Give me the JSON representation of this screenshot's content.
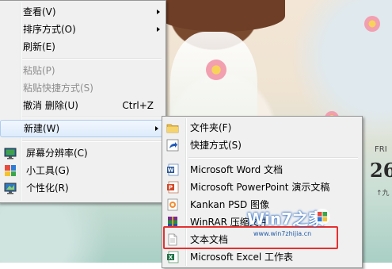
{
  "context_menu": {
    "items": [
      {
        "label": "查看(V)",
        "has_submenu": true
      },
      {
        "label": "排序方式(O)",
        "has_submenu": true
      },
      {
        "label": "刷新(E)"
      },
      {
        "label": "粘贴(P)",
        "disabled": true
      },
      {
        "label": "粘贴快捷方式(S)",
        "disabled": true
      },
      {
        "label": "撤消 删除(U)",
        "shortcut": "Ctrl+Z"
      },
      {
        "label": "新建(W)",
        "has_submenu": true,
        "highlighted": true
      },
      {
        "label": "屏幕分辨率(C)",
        "icon": "display-icon"
      },
      {
        "label": "小工具(G)",
        "icon": "gadgets-icon"
      },
      {
        "label": "个性化(R)",
        "icon": "personalize-icon"
      }
    ]
  },
  "new_submenu": {
    "items": [
      {
        "label": "文件夹(F)",
        "icon": "folder-icon"
      },
      {
        "label": "快捷方式(S)",
        "icon": "shortcut-icon"
      },
      {
        "label": "Microsoft Word 文档",
        "icon": "word-doc-icon"
      },
      {
        "label": "Microsoft PowerPoint 演示文稿",
        "icon": "powerpoint-icon"
      },
      {
        "label": "Kankan PSD 图像",
        "icon": "psd-image-icon"
      },
      {
        "label": "WinRAR 压缩文件",
        "icon": "winrar-icon"
      },
      {
        "label": "文本文档",
        "icon": "text-document-icon",
        "highlighted": true
      },
      {
        "label": "Microsoft Excel 工作表",
        "icon": "excel-icon"
      }
    ]
  },
  "gadget": {
    "day": "FRI",
    "date": "26",
    "sub": "↑九"
  },
  "watermark": {
    "text": "Win7之家",
    "url": "www.win7zhijia.cn"
  },
  "colors": {
    "highlight_border": "#e53030",
    "menu_bg": "#f0f0f0"
  }
}
